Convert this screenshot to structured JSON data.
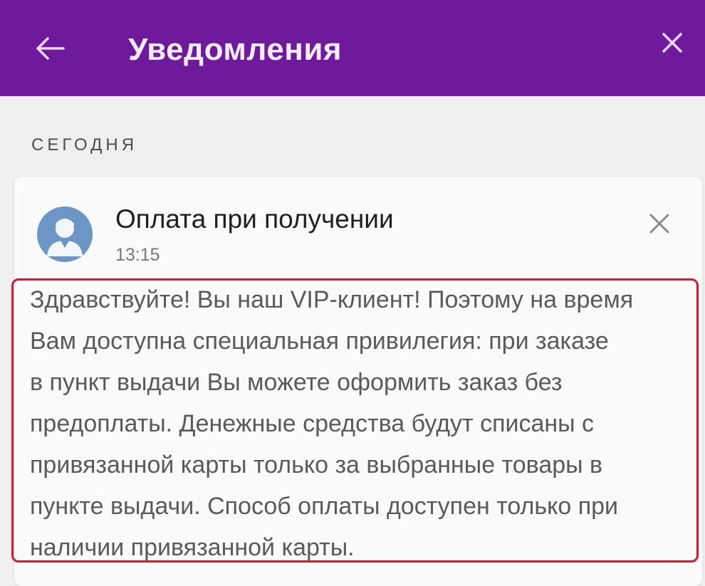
{
  "header": {
    "title": "Уведомления",
    "background_color": "#6f1a9c",
    "back_icon": "arrow-left-icon",
    "close_icon": "close-icon"
  },
  "section": {
    "label": "СЕГОДНЯ"
  },
  "notification": {
    "title": "Оплата при получении",
    "time": "13:15",
    "avatar_icon": "user-avatar-icon",
    "avatar_color": "#6b96c5",
    "dismiss_icon": "close-icon",
    "message": "Здравствуйте! Вы наш VIP-клиент! Поэтому на время\nВам доступна специальная привилегия: при заказе\nв пункт выдачи Вы можете оформить заказ без\nпредоплаты. Денежные средства будут списаны с\nпривязанной карты только за выбранные товары в\nпункте выдачи. Способ оплаты доступен только при\nналичии привязанной карты."
  },
  "highlight_color": "#d8182f"
}
